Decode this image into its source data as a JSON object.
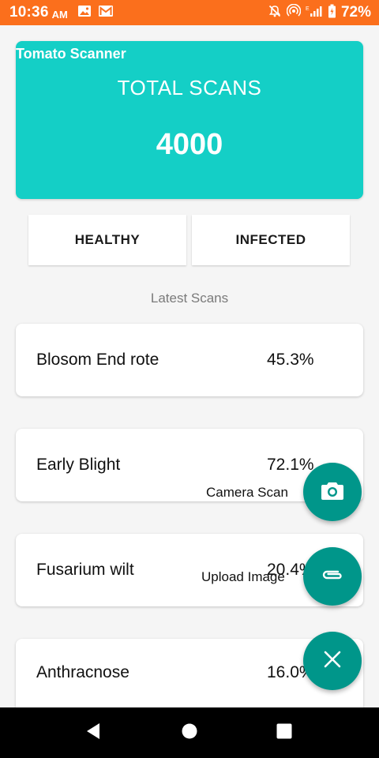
{
  "status_bar": {
    "time": "10:36",
    "ampm": "AM",
    "battery_percent": "72%",
    "background": "#fb6f1c"
  },
  "app": {
    "title": "Tomato Scanner"
  },
  "summary": {
    "total_label": "TOTAL SCANS",
    "total_value": "4000",
    "accent": "#14cfc6"
  },
  "filters": {
    "healthy": "HEALTHY",
    "infected": "INFECTED"
  },
  "latest_label": "Latest Scans",
  "scans": [
    {
      "name": "Blosom End rote",
      "percent": "45.3%"
    },
    {
      "name": "Early Blight",
      "percent": "72.1%"
    },
    {
      "name": "Fusarium wilt",
      "percent": "20.4%"
    },
    {
      "name": "Anthracnose",
      "percent": "16.0%"
    }
  ],
  "fab_menu": {
    "camera_label": "Camera Scan",
    "upload_label": "Upload Image",
    "color": "#00968a",
    "icons": [
      "camera-icon",
      "attachment-icon",
      "close-icon"
    ]
  },
  "nav_icons": [
    "back-icon",
    "home-icon",
    "recents-icon"
  ]
}
